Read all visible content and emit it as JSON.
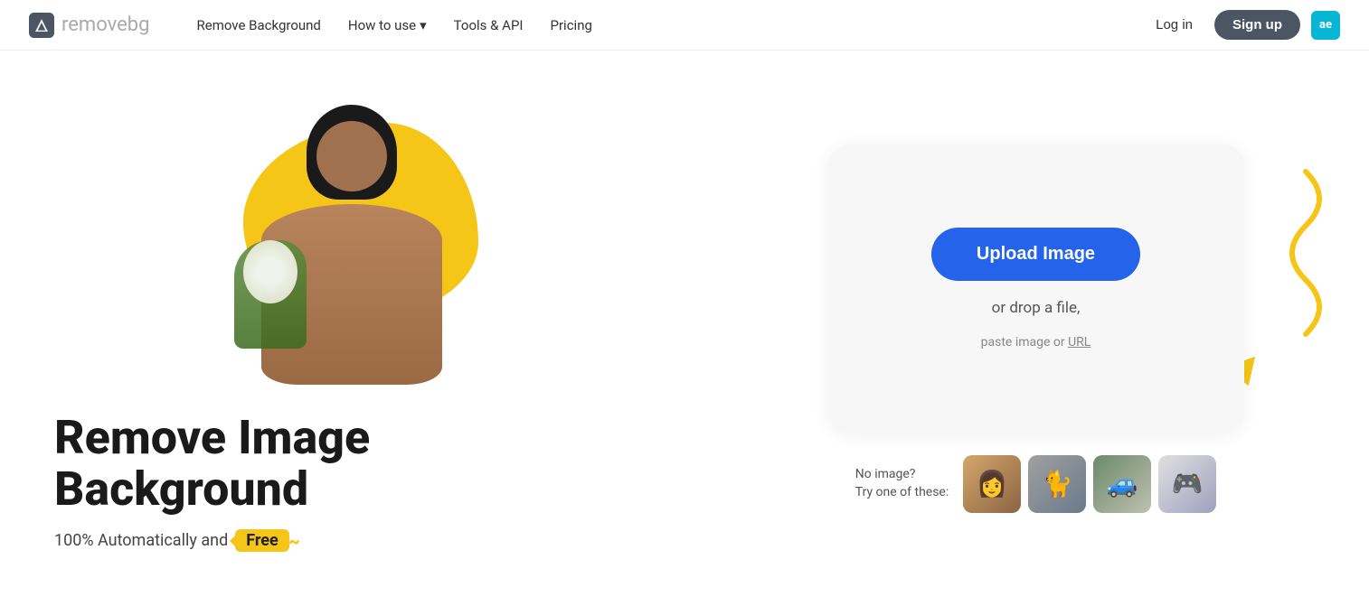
{
  "nav": {
    "logo_text_main": "remove",
    "logo_text_accent": "bg",
    "links": [
      {
        "id": "remove-background",
        "label": "Remove Background",
        "has_dropdown": false
      },
      {
        "id": "how-to-use",
        "label": "How to use",
        "has_dropdown": true
      },
      {
        "id": "tools-api",
        "label": "Tools & API",
        "has_dropdown": false
      },
      {
        "id": "pricing",
        "label": "Pricing",
        "has_dropdown": false
      }
    ],
    "login_label": "Log in",
    "signup_label": "Sign up",
    "avatar_initials": "ae"
  },
  "hero": {
    "heading_line1": "Remove Image",
    "heading_line2": "Background",
    "subtext": "100% Automatically and",
    "free_label": "Free"
  },
  "upload": {
    "button_label": "Upload Image",
    "drop_text": "or drop a file,",
    "paste_text": "paste image or",
    "url_label": "URL"
  },
  "samples": {
    "label_line1": "No image?",
    "label_line2": "Try one of these:",
    "thumbs": [
      {
        "id": "sample-1",
        "desc": "woman with flowers"
      },
      {
        "id": "sample-2",
        "desc": "cat"
      },
      {
        "id": "sample-3",
        "desc": "car"
      },
      {
        "id": "sample-4",
        "desc": "gamepad"
      }
    ]
  },
  "icons": {
    "chevron_down": "▾",
    "logo_shape": "◆"
  }
}
